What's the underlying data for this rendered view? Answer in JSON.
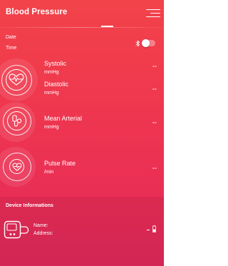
{
  "app": {
    "title": "Blood Pressure",
    "accent_color": "#f0384e",
    "menu_icon": "hamburger-menu-icon"
  },
  "status": {
    "date_label": "Date",
    "time_label": "Time",
    "bluetooth_icon": "bluetooth-icon",
    "bluetooth_enabled": false
  },
  "metrics": {
    "systolic": {
      "name": "Systolic",
      "unit": "mmHg",
      "value": "--",
      "icon": "heart-pulse-icon"
    },
    "diastolic": {
      "name": "Diastolic",
      "unit": "mmHg",
      "value": "--"
    },
    "mean_arterial": {
      "name": "Mean Arterial",
      "unit": "mmHg",
      "value": "--",
      "icon": "blood-pressure-cuff-icon"
    },
    "pulse_rate": {
      "name": "Pulse Rate",
      "unit": "/min",
      "value": "--",
      "icon": "heartbeat-icon"
    }
  },
  "device": {
    "section_title": "Device Informations",
    "name_label": "Name:",
    "address_label": "Address:",
    "battery_value": "-",
    "device_icon": "blood-pressure-monitor-icon",
    "battery_icon": "battery-icon"
  }
}
